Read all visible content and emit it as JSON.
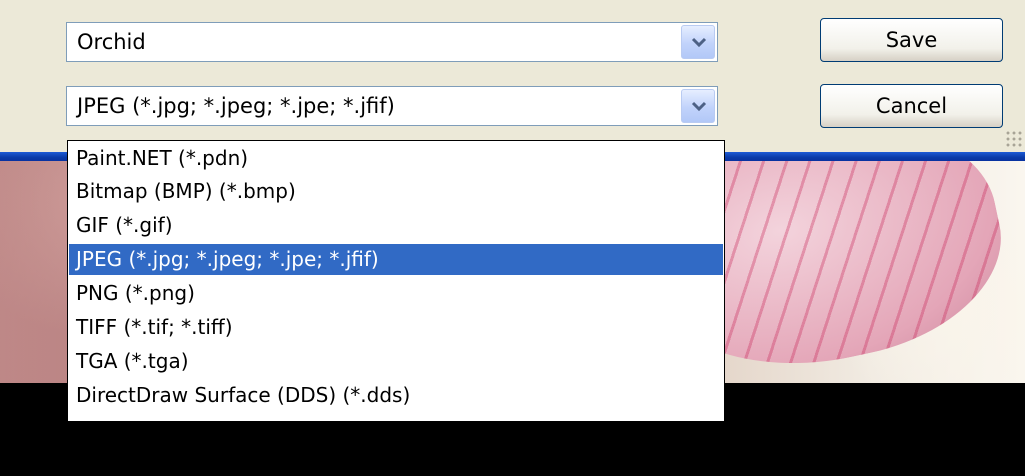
{
  "name_combo": {
    "value": "Orchid"
  },
  "type_combo": {
    "value": "JPEG (*.jpg; *.jpeg; *.jpe; *.jfif)"
  },
  "buttons": {
    "save": "Save",
    "cancel": "Cancel"
  },
  "file_types": [
    {
      "label": "Paint.NET (*.pdn)",
      "selected": false
    },
    {
      "label": "Bitmap (BMP) (*.bmp)",
      "selected": false
    },
    {
      "label": "GIF (*.gif)",
      "selected": false
    },
    {
      "label": "JPEG (*.jpg; *.jpeg; *.jpe; *.jfif)",
      "selected": true
    },
    {
      "label": "PNG (*.png)",
      "selected": false
    },
    {
      "label": "TIFF (*.tif; *.tiff)",
      "selected": false
    },
    {
      "label": "TGA (*.tga)",
      "selected": false
    },
    {
      "label": "DirectDraw Surface (DDS) (*.dds)",
      "selected": false
    }
  ],
  "colors": {
    "dialog_bg": "#ece9d8",
    "selection": "#316ac5",
    "title_bar_blue": "#0a3ba8",
    "button_border": "#003c74"
  },
  "icons": {
    "dropdown_arrow": "chevron-down-icon",
    "resize_grip": "resize-grip-icon"
  }
}
